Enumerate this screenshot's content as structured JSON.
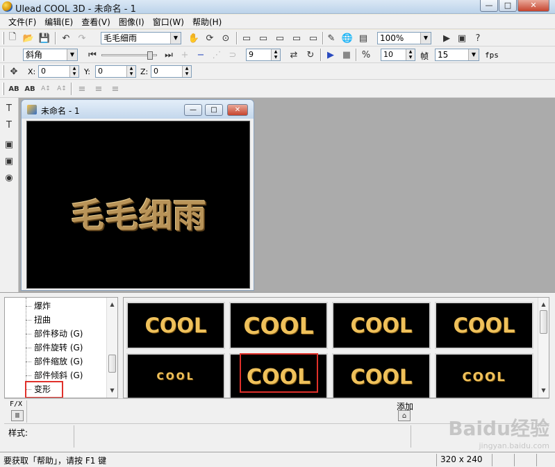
{
  "window": {
    "title": "Ulead COOL 3D - 未命名 - 1",
    "minimize": "—",
    "maximize": "□",
    "close": "✕"
  },
  "menu": [
    "文件(F)",
    "编辑(E)",
    "查看(V)",
    "图像(I)",
    "窗口(W)",
    "帮助(H)"
  ],
  "toolbar1": {
    "text_combo": "毛毛细雨",
    "zoom_combo": "100%"
  },
  "toolbar2": {
    "bevel_combo": "斜角",
    "frame_spin": "9",
    "frames_total": "10",
    "frames_label": "帧",
    "fps_value": "15",
    "fps_label": "fps"
  },
  "toolbar3": {
    "x_label": "X:",
    "x_value": "0",
    "y_label": "Y:",
    "y_value": "0",
    "z_label": "Z:",
    "z_value": "0"
  },
  "document": {
    "title": "未命名 - 1",
    "canvas_text": "毛毛细雨"
  },
  "tree": {
    "items": [
      "爆炸",
      "扭曲",
      "部件移动 (G)",
      "部件旋转 (G)",
      "部件缩放 (G)",
      "部件倾斜 (G)",
      "变形"
    ],
    "selected": "变形"
  },
  "thumbnails": {
    "labels": [
      "COOL",
      "COOL",
      "COOL",
      "COOL",
      "COOL",
      "COOL",
      "COOL",
      "COOL"
    ]
  },
  "fx": {
    "label": "F/X",
    "add_label": "添加"
  },
  "style": {
    "label": "样式:"
  },
  "status": {
    "hint": "要获取「帮助」，请按 F1 键",
    "size": "320 x 240"
  },
  "watermark": {
    "main": "Baidu经验",
    "sub": "jingyan.baidu.com"
  },
  "colors": {
    "canvas_bg": "#000000",
    "gold_text": "#efc15b",
    "highlight_box": "#e0302a",
    "workspace": "#ababab"
  }
}
